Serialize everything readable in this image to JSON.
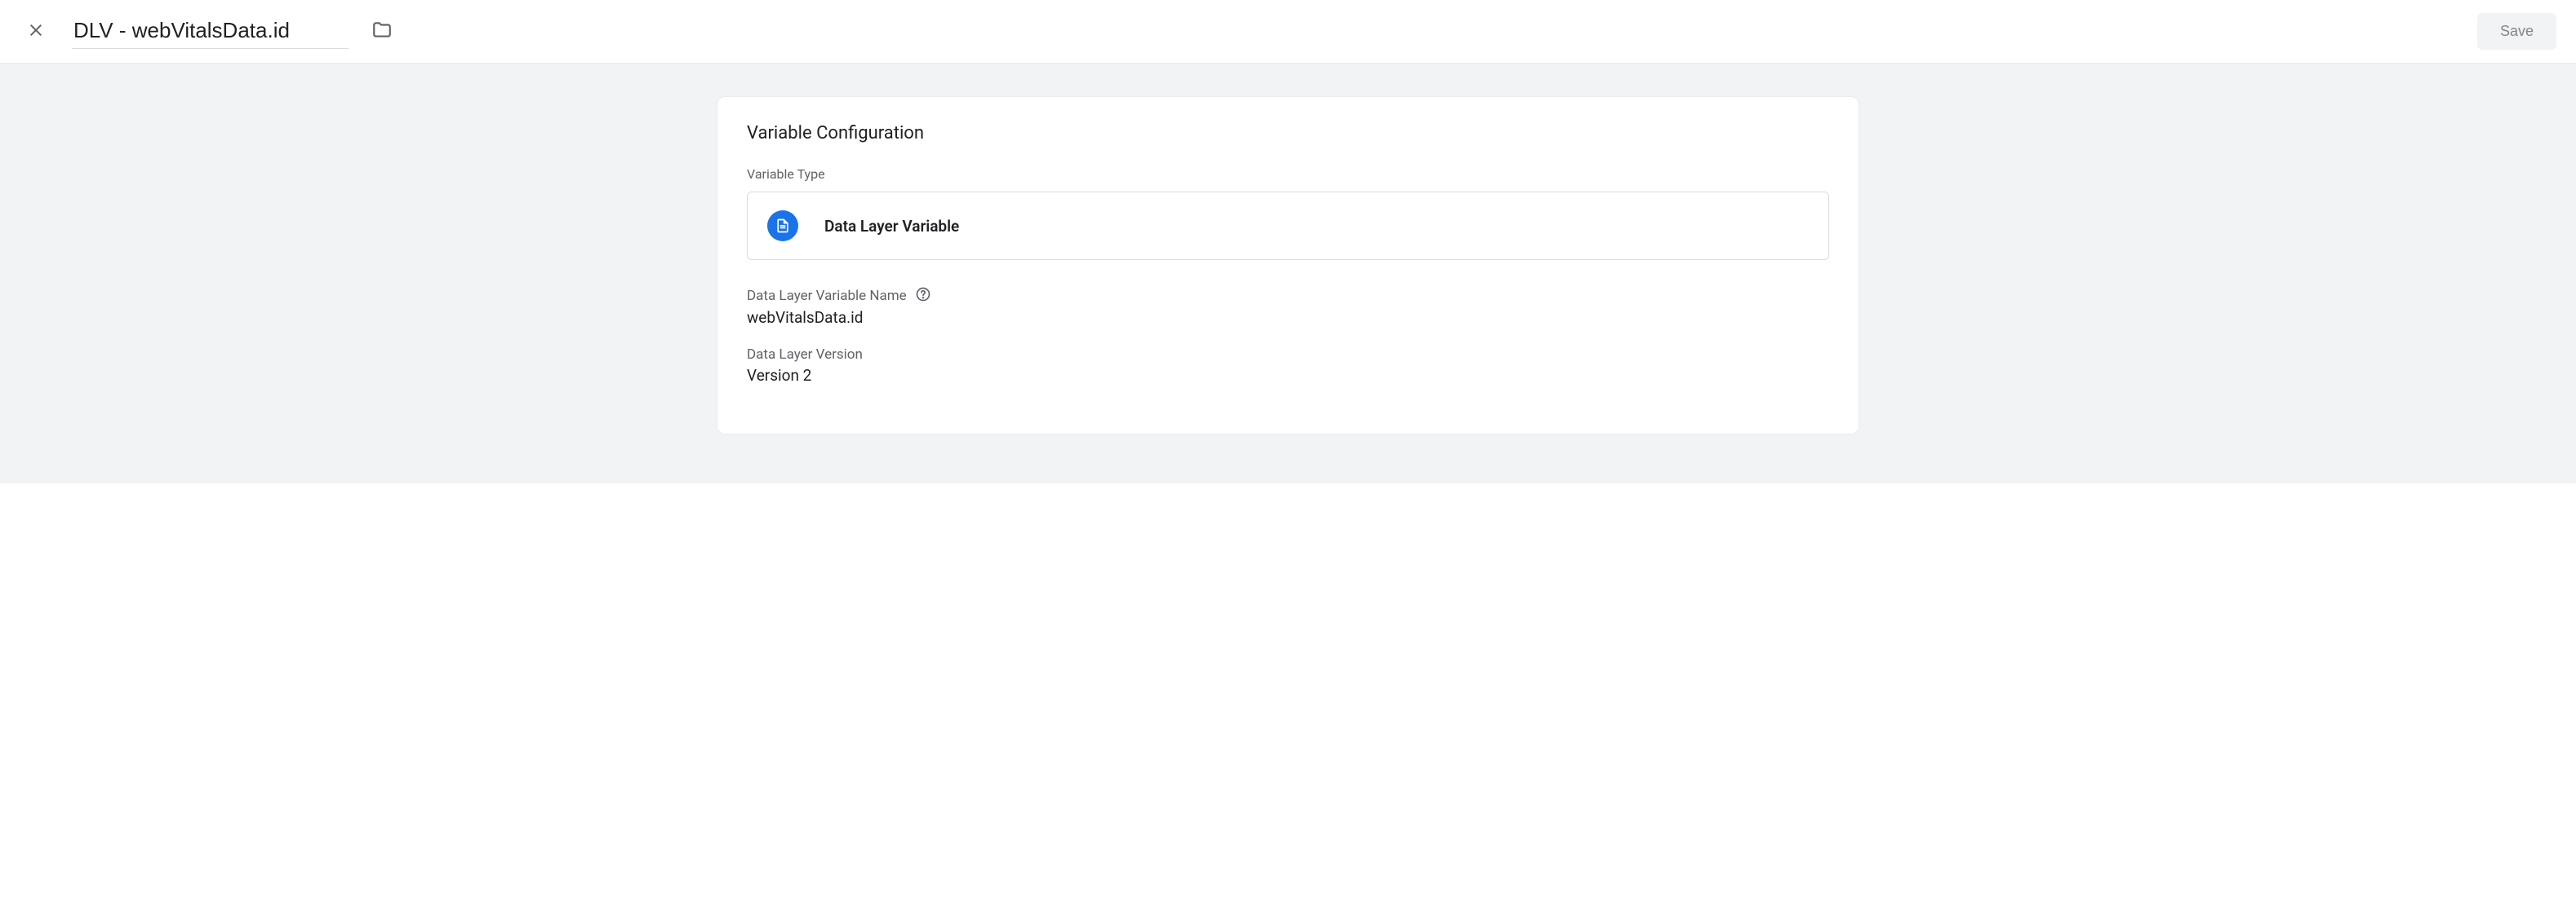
{
  "header": {
    "title_value": "DLV - webVitalsData.id",
    "save_label": "Save"
  },
  "config": {
    "card_title": "Variable Configuration",
    "type_section_label": "Variable Type",
    "type_name": "Data Layer Variable",
    "fields": {
      "dlv_name": {
        "label": "Data Layer Variable Name",
        "value": "webVitalsData.id"
      },
      "dlv_version": {
        "label": "Data Layer Version",
        "value": "Version 2"
      }
    }
  }
}
